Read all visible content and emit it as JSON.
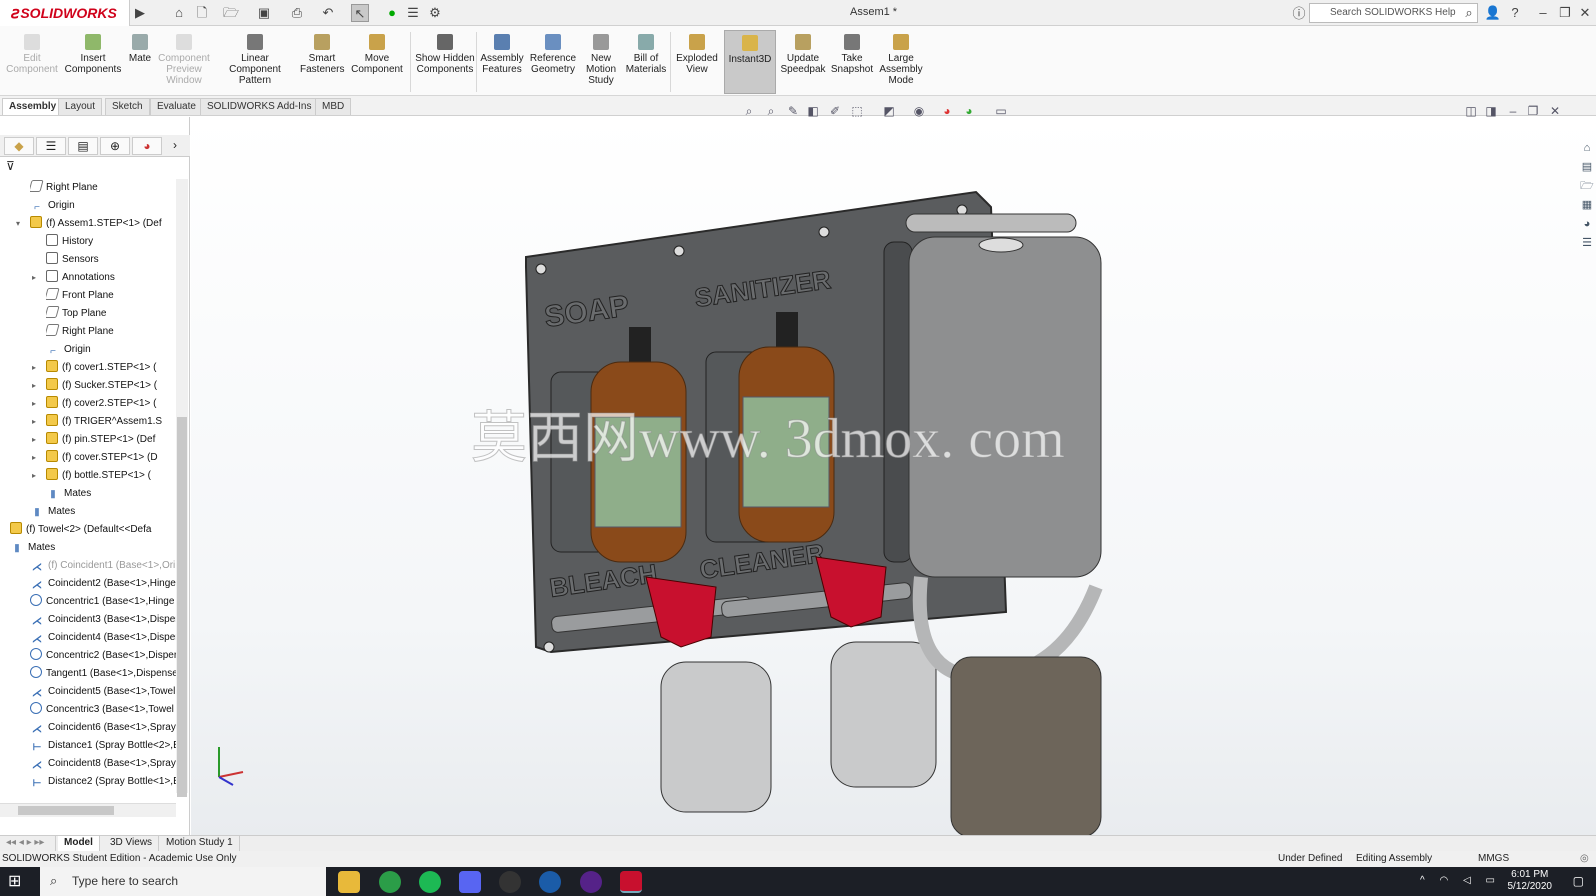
{
  "app": {
    "brand": "SOLIDWORKS",
    "brand_prefix": "3S",
    "doc_title": "Assem1 *",
    "search_placeholder": "Search SOLIDWORKS Help"
  },
  "ribbon": {
    "edit_component": "Edit Component",
    "insert_components": "Insert Components",
    "mate": "Mate",
    "component_preview": "Component Preview Window",
    "linear_pattern": "Linear Component Pattern",
    "smart_fasteners": "Smart Fasteners",
    "move_component": "Move Component",
    "show_hidden": "Show Hidden Components",
    "assembly_features": "Assembly Features",
    "reference_geometry": "Reference Geometry",
    "new_motion_study": "New Motion Study",
    "bill_of_materials": "Bill of Materials",
    "exploded_view": "Exploded View",
    "instant3d": "Instant3D",
    "update_speedpak": "Update Speedpak",
    "take_snapshot": "Take Snapshot",
    "large_assembly_mode": "Large Assembly Mode"
  },
  "tabs": [
    "Assembly",
    "Layout",
    "Sketch",
    "Evaluate",
    "SOLIDWORKS Add-Ins",
    "MBD"
  ],
  "tree": [
    {
      "label": "Right Plane",
      "icon": "plane-icon"
    },
    {
      "label": "Origin",
      "icon": "origin-icon"
    },
    {
      "label": "(f) Assem1.STEP<1> (Def",
      "icon": "assembly-icon"
    },
    {
      "label": "History",
      "icon": "history-icon"
    },
    {
      "label": "Sensors",
      "icon": "sensor-icon"
    },
    {
      "label": "Annotations",
      "icon": "annotation-icon"
    },
    {
      "label": "Front Plane",
      "icon": "plane-icon"
    },
    {
      "label": "Top Plane",
      "icon": "plane-icon"
    },
    {
      "label": "Right Plane",
      "icon": "plane-icon"
    },
    {
      "label": "Origin",
      "icon": "origin-icon"
    },
    {
      "label": "(f) cover1.STEP<1> (",
      "icon": "part-icon"
    },
    {
      "label": "(f) Sucker.STEP<1> (",
      "icon": "part-icon"
    },
    {
      "label": "(f) cover2.STEP<1> (",
      "icon": "part-icon"
    },
    {
      "label": "(f) TRIGER^Assem1.S",
      "icon": "part-icon"
    },
    {
      "label": "(f) pin.STEP<1> (Def",
      "icon": "part-icon"
    },
    {
      "label": "(f) cover.STEP<1> (D",
      "icon": "part-icon"
    },
    {
      "label": "(f) bottle.STEP<1> (",
      "icon": "part-icon"
    },
    {
      "label": "Mates",
      "icon": "mates-icon"
    },
    {
      "label": "Mates",
      "icon": "mates-icon"
    },
    {
      "label": "(f) Towel<2> (Default<<Defa",
      "icon": "assembly-icon"
    },
    {
      "label": "Mates",
      "icon": "mates-icon"
    },
    {
      "label": "(f) Coincident1 (Base<1>,Ori",
      "icon": "coincident-icon"
    },
    {
      "label": "Coincident2 (Base<1>,Hinge",
      "icon": "coincident-icon"
    },
    {
      "label": "Concentric1 (Base<1>,Hinge",
      "icon": "concentric-icon"
    },
    {
      "label": "Coincident3 (Base<1>,Disper",
      "icon": "coincident-icon"
    },
    {
      "label": "Coincident4 (Base<1>,Disper",
      "icon": "coincident-icon"
    },
    {
      "label": "Concentric2 (Base<1>,Disper",
      "icon": "concentric-icon"
    },
    {
      "label": "Tangent1 (Base<1>,Dispense",
      "icon": "tangent-icon"
    },
    {
      "label": "Coincident5 (Base<1>,Towel",
      "icon": "coincident-icon"
    },
    {
      "label": "Concentric3 (Base<1>,Towel",
      "icon": "concentric-icon"
    },
    {
      "label": "Coincident6 (Base<1>,Spray",
      "icon": "coincident-icon"
    },
    {
      "label": "Distance1 (Spray Bottle<2>,B",
      "icon": "distance-icon"
    },
    {
      "label": "Coincident8 (Base<1>,Spray",
      "icon": "coincident-icon"
    },
    {
      "label": "Distance2 (Spray Bottle<1>,B",
      "icon": "distance-icon"
    }
  ],
  "model": {
    "labels": [
      "SOAP",
      "SANITIZER",
      "BLEACH",
      "CLEANER"
    ],
    "watermark": "莫西网www. 3dmox. com"
  },
  "bottom_tabs": [
    "Model",
    "3D Views",
    "Motion Study 1"
  ],
  "status": {
    "edition": "SOLIDWORKS Student Edition - Academic Use Only",
    "state": "Under Defined",
    "mode": "Editing Assembly",
    "units": "MMGS"
  },
  "taskbar": {
    "search_placeholder": "Type here to search",
    "time": "6:01 PM",
    "date": "5/12/2020"
  }
}
